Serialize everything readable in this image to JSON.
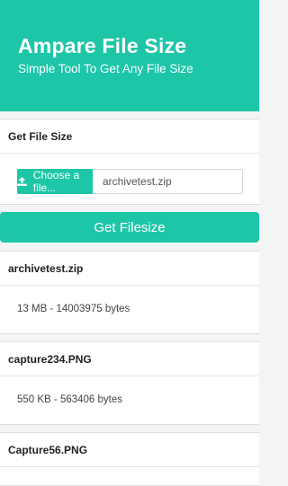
{
  "header": {
    "title": "Ampare File Size",
    "subtitle": "Simple Tool To Get Any File Size"
  },
  "form": {
    "heading": "Get File Size",
    "choose_label": "Choose a file...",
    "upload_icon": "upload-icon",
    "file_value": "archivetest.zip"
  },
  "action": {
    "get_label": "Get Filesize"
  },
  "results": [
    {
      "name": "archivetest.zip",
      "size": "13 MB - 14003975 bytes"
    },
    {
      "name": "capture234.PNG",
      "size": "550 KB - 563406 bytes"
    },
    {
      "name": "Capture56.PNG",
      "size": ""
    }
  ],
  "colors": {
    "accent": "#1ec6a8",
    "background": "#f3f4f4"
  }
}
